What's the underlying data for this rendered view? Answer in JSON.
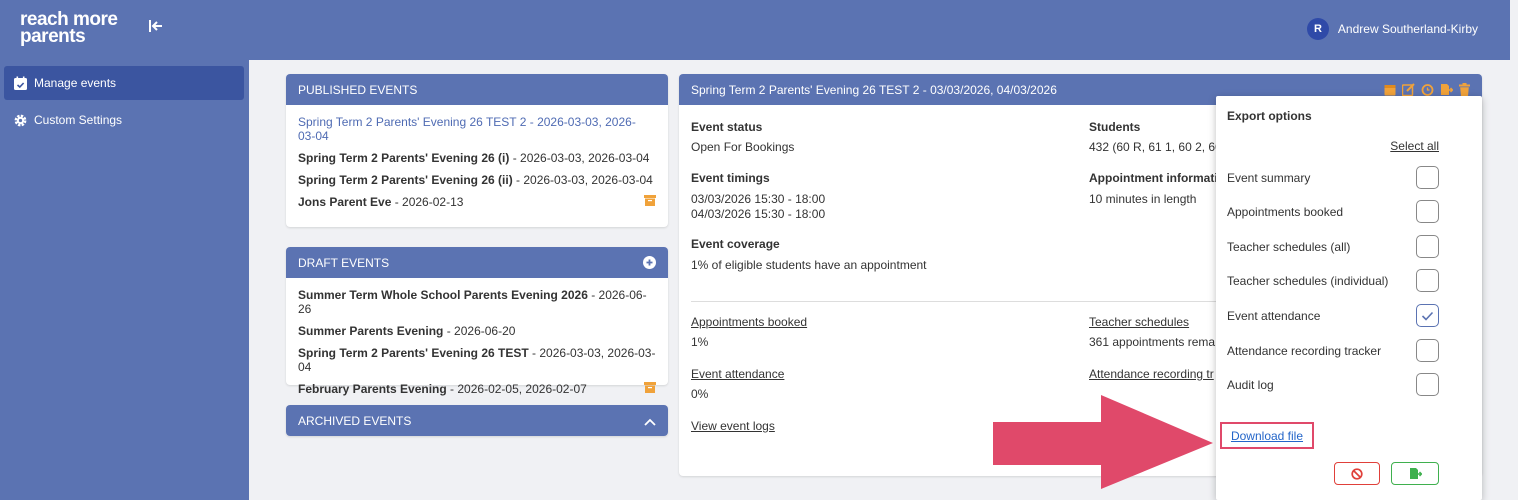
{
  "app": {
    "logo_line1": "reach more",
    "logo_line2": "parents",
    "user_initial": "R",
    "user_name": "Andrew Southerland-Kirby"
  },
  "sidebar": {
    "items": [
      {
        "label": "Manage events",
        "icon": "calendar-check-icon"
      },
      {
        "label": "Custom Settings",
        "icon": "gear-icon"
      }
    ]
  },
  "published": {
    "title": "PUBLISHED EVENTS",
    "events": [
      {
        "name": "Spring Term 2 Parents' Evening 26 TEST 2",
        "dates": " - 2026-03-03, 2026-03-04"
      },
      {
        "name": "Spring Term 2 Parents' Evening 26 (i)",
        "dates": " - 2026-03-03, 2026-03-04"
      },
      {
        "name": "Spring Term 2 Parents' Evening 26 (ii)",
        "dates": " - 2026-03-03, 2026-03-04"
      },
      {
        "name": "Jons Parent Eve",
        "dates": " - 2026-02-13"
      }
    ]
  },
  "draft": {
    "title": "DRAFT EVENTS",
    "events": [
      {
        "name": "Summer Term Whole School Parents Evening 2026",
        "dates": " - 2026-06-26"
      },
      {
        "name": "Summer Parents Evening",
        "dates": " - 2026-06-20"
      },
      {
        "name": "Spring Term 2 Parents' Evening 26 TEST",
        "dates": " - 2026-03-03, 2026-03-04"
      },
      {
        "name": "February Parents Evening",
        "dates": " - 2026-02-05, 2026-02-07"
      }
    ]
  },
  "archived": {
    "title": "ARCHIVED EVENTS"
  },
  "detail": {
    "title": "Spring Term 2 Parents' Evening 26 TEST 2 - 03/03/2026, 04/03/2026",
    "status_label": "Event status",
    "status_value": "Open For Bookings",
    "timings_label": "Event timings",
    "timings_1": "03/03/2026 15:30 - 18:00",
    "timings_2": "04/03/2026 15:30 - 18:00",
    "coverage_label": "Event coverage",
    "coverage_value": "1% of eligible students have an appointment",
    "students_label": "Students",
    "students_value": "432 (60 R, 61 1, 60 2, 60",
    "appt_info_label": "Appointment informati",
    "appt_info_value": "10 minutes in length",
    "appointments_booked_link": "Appointments booked",
    "appointments_booked_value": "1%",
    "teacher_schedules_link": "Teacher schedules",
    "teacher_schedules_value": "361 appointments rema",
    "attendance_link": "Event attendance",
    "attendance_value": "0%",
    "tracker_link": "Attendance recording tr",
    "logs_link": "View event logs"
  },
  "export": {
    "title": "Export options",
    "select_all": "Select all",
    "options": [
      {
        "label": "Event summary",
        "checked": false
      },
      {
        "label": "Appointments booked",
        "checked": false
      },
      {
        "label": "Teacher schedules (all)",
        "checked": false
      },
      {
        "label": "Teacher schedules (individual)",
        "checked": false
      },
      {
        "label": "Event attendance",
        "checked": true
      },
      {
        "label": "Attendance recording tracker",
        "checked": false
      },
      {
        "label": "Audit log",
        "checked": false
      }
    ],
    "download_label": "Download file"
  },
  "colors": {
    "header": "#5b73b2",
    "sidebar_active": "#3b55a0",
    "accent_orange": "#f0a23a",
    "cancel_red": "#e0403a",
    "confirm_green": "#3fb04e",
    "annotation_pink": "#e0496a"
  }
}
